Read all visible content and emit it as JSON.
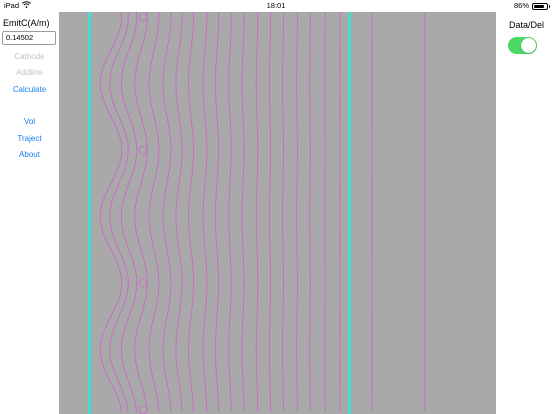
{
  "status_bar": {
    "device": "iPad",
    "time": "18:01",
    "battery": "86%",
    "battery_level": 0.86,
    "wifi_icon": "wifi-icon"
  },
  "left_panel": {
    "emit_label": "EmitC(A/m)",
    "emit_value": "0.14502",
    "cathode_label": "Cathode",
    "addline_label": "Addline",
    "calculate_label": "Calculate",
    "vol_label": "Vol",
    "traject_label": "Traject",
    "about_label": "About"
  },
  "right_panel": {
    "toggle_label": "Data/Del",
    "toggle_on": true
  },
  "colors": {
    "plot_background": "#a9a9a9",
    "electrode": "#40e0d0",
    "contour": "#cc66cc",
    "accent": "#1a7ef0",
    "toggle_on": "#4cd964"
  }
}
